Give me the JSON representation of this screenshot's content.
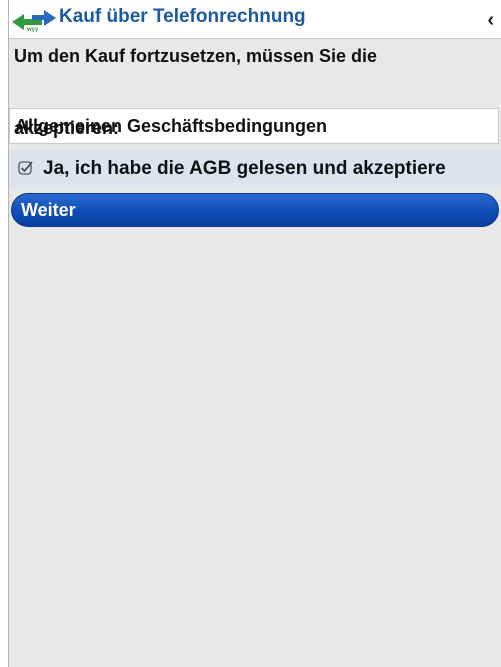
{
  "titlebar": {
    "title": "Kauf über Telefonrechnung",
    "back_icon": "chevron-left-icon",
    "logo_icon": "green-arrow-logo-icon",
    "logo_text": "wyy"
  },
  "message": {
    "line1": "Um den Kauf fortzusetzen, müssen Sie die",
    "line2": "Allgemeinen Geschäftsbedingungen",
    "line3": "akzeptieren:"
  },
  "terms_checkbox": {
    "label": "Ja, ich habe die AGB gelesen und akzeptiere",
    "checked": true
  },
  "continue_button": {
    "label": "Weiter"
  },
  "colors": {
    "title": "#1c5aa0",
    "button": "#1050b8",
    "background": "#e8e8e8",
    "checkbox_row": "#dde2ec"
  }
}
